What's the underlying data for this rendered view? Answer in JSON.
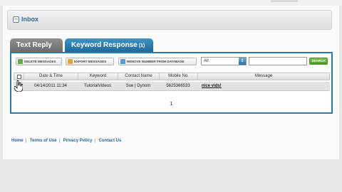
{
  "inbox": {
    "title": "Inbox"
  },
  "tabs": [
    {
      "label": "Text Reply"
    },
    {
      "label": "Keyword Response",
      "count": "(1)"
    }
  ],
  "toolbar": {
    "delete_label": "DELETE MESSAGES",
    "export_label": "EXPORT MESSAGES",
    "remove_label": "REMOVE NUMBER FROM DATABASE",
    "filter_value": "All",
    "search_value": "",
    "search_label": "SEARCH"
  },
  "table": {
    "columns": [
      "Date & Time",
      "Keyword",
      "Contact Name",
      "Mobile No.",
      "Message"
    ],
    "rows": [
      {
        "date": "04/14/2011 11:34",
        "keyword": "TutorialVideos",
        "contact": "Sue | Dynom",
        "mobile": "5625366533",
        "message": "nice vids!"
      }
    ]
  },
  "pager": {
    "page": "1"
  },
  "footer": {
    "links": [
      "Home",
      "Terms of Use",
      "Privacy Policy",
      "Contact Us"
    ]
  },
  "colors": {
    "accent": "#2a7bb0",
    "tab_active": "#1c6b9d",
    "tab_inactive": "#6b6b6b",
    "link": "#2a6496"
  }
}
